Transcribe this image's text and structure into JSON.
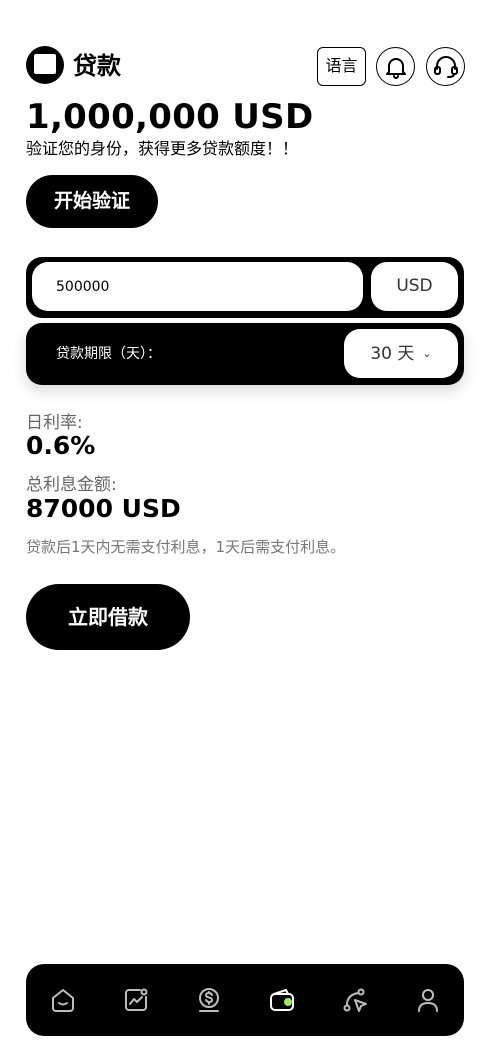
{
  "header": {
    "title": "贷款",
    "language_label": "语言",
    "logo_icon": "app-logo-icon",
    "bell_icon": "bell-icon",
    "support_icon": "headset-icon"
  },
  "credit": {
    "limit": "1,000,000 USD",
    "verify_hint": "验证您的身份，获得更多贷款额度！！",
    "verify_button": "开始验证"
  },
  "form": {
    "amount_value": "500000",
    "currency": "USD",
    "term_label": "贷款期限（天）：",
    "term_value": "30 天"
  },
  "stats": {
    "daily_rate_label": "日利率:",
    "daily_rate_value": "0.6%",
    "total_interest_label": "总利息金额:",
    "total_interest_value": "87000 USD",
    "note": "贷款后1天内无需支付利息，1天后需支付利息。"
  },
  "actions": {
    "borrow_button": "立即借款"
  },
  "tabbar": {
    "tabs": [
      {
        "icon": "home-icon",
        "active": false
      },
      {
        "icon": "chart-icon",
        "active": false
      },
      {
        "icon": "coin-icon",
        "active": false
      },
      {
        "icon": "wallet-icon",
        "active": true
      },
      {
        "icon": "cursor-path-icon",
        "active": false
      },
      {
        "icon": "user-icon",
        "active": false
      }
    ],
    "active_accent": "#9ee86a"
  }
}
